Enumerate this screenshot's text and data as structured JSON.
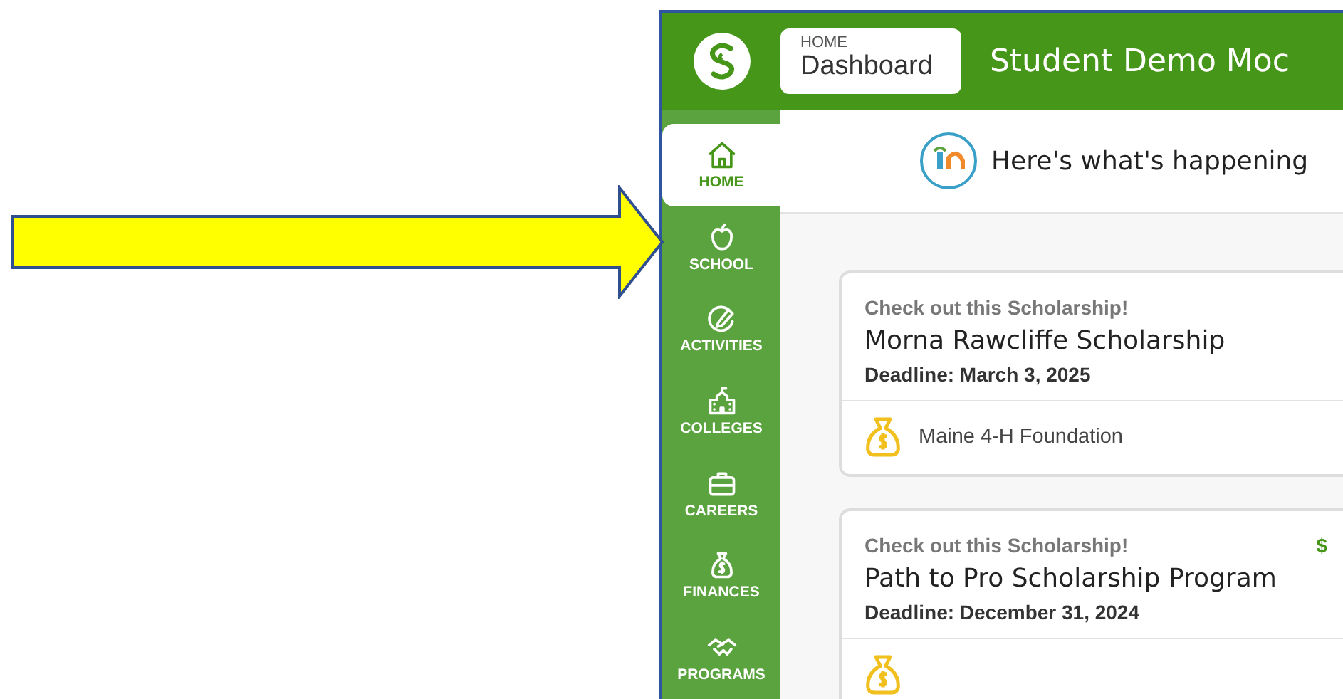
{
  "header": {
    "breadcrumb": "HOME",
    "page_title": "Dashboard",
    "site_title": "Student Demo Moc"
  },
  "sidebar": {
    "items": [
      {
        "label": "HOME",
        "kind": "home",
        "selected": true
      },
      {
        "label": "SCHOOL",
        "kind": "school",
        "selected": false
      },
      {
        "label": "ACTIVITIES",
        "kind": "activities",
        "selected": false
      },
      {
        "label": "COLLEGES",
        "kind": "colleges",
        "selected": false
      },
      {
        "label": "CAREERS",
        "kind": "careers",
        "selected": false
      },
      {
        "label": "FINANCES",
        "kind": "finances",
        "selected": false
      },
      {
        "label": "PROGRAMS",
        "kind": "programs",
        "selected": false
      }
    ]
  },
  "welcome": {
    "text": "Here's what's happening"
  },
  "cards": [
    {
      "eyebrow": "Check out this Scholarship!",
      "title": "Morna Rawcliffe Scholarship",
      "deadline": "Deadline: March 3, 2025",
      "sponsor": "Maine 4-H Foundation"
    },
    {
      "eyebrow": "Check out this Scholarship!",
      "amount": "$",
      "title": "Path to Pro Scholarship Program",
      "deadline": "Deadline: December 31, 2024"
    }
  ]
}
